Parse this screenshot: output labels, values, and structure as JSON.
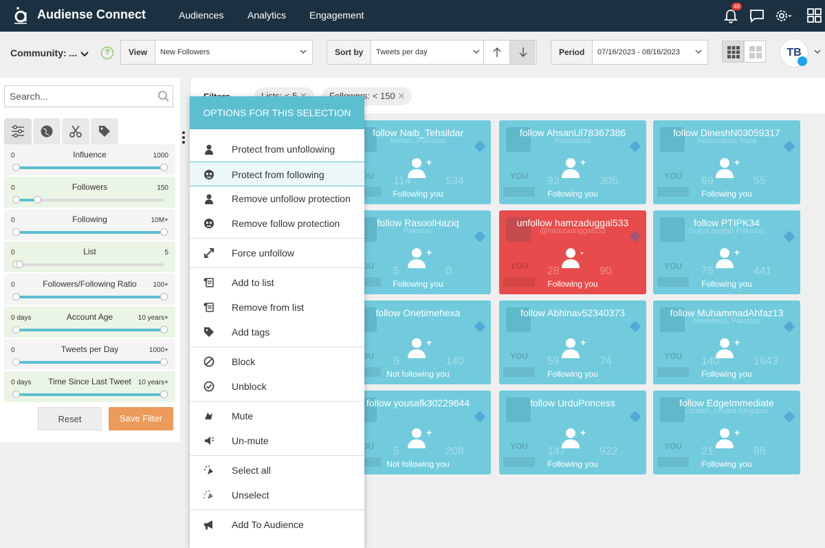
{
  "topbar": {
    "brand": "Audiense Connect",
    "nav": [
      "Audiences",
      "Analytics",
      "Engagement"
    ],
    "notification_count": "49"
  },
  "toolbar": {
    "community_label": "Community: ...",
    "help": "?",
    "view_label": "View",
    "view_value": "New Followers",
    "sort_label": "Sort by",
    "sort_value": "Tweets per day",
    "period_label": "Period",
    "period_value": "07/16/2023 - 08/16/2023",
    "avatar_text": "TB"
  },
  "sidebar": {
    "search_placeholder": "Search...",
    "filters": [
      {
        "name": "Influence",
        "lo": "0",
        "hi": "1000",
        "from": 0,
        "to": 1
      },
      {
        "name": "Followers",
        "lo": "0",
        "hi": "150",
        "from": 0,
        "to": 0.15
      },
      {
        "name": "Following",
        "lo": "0",
        "hi": "10M+",
        "from": 0,
        "to": 1
      },
      {
        "name": "List",
        "lo": "0",
        "hi": "5",
        "from": 0,
        "to": 0.03
      },
      {
        "name": "Followers/Following Ratio",
        "lo": "0",
        "hi": "100+",
        "from": 0,
        "to": 1
      },
      {
        "name": "Account Age",
        "lo": "0 days",
        "hi": "10 years+",
        "from": 0,
        "to": 1
      },
      {
        "name": "Tweets per Day",
        "lo": "0",
        "hi": "1000+",
        "from": 0,
        "to": 1
      },
      {
        "name": "Time Since Last Tweet",
        "lo": "0 days",
        "hi": "10 years+",
        "from": 0,
        "to": 1
      }
    ],
    "reset_label": "Reset",
    "save_label": "Save Filter"
  },
  "filters_bar": {
    "label": "Filters",
    "chips": [
      "Lists: < 5",
      "Followers: < 150"
    ]
  },
  "menu": {
    "header": "OPTIONS FOR THIS SELECTION",
    "items": [
      "Protect from unfollowing",
      "Protect from following",
      "Remove unfollow protection",
      "Remove follow protection",
      "Force unfollow",
      "Add to list",
      "Remove from list",
      "Add tags",
      "Block",
      "Unblock",
      "Mute",
      "Un-mute",
      "Select all",
      "Unselect",
      "Add To Audience"
    ]
  },
  "cards": [
    {
      "title": "follow Naib_Tehsildar",
      "sub": "Multan, Pakistan",
      "n1": "114",
      "n2": "534",
      "status": "Following you",
      "you": "YOU",
      "red": false
    },
    {
      "title": "follow AhsanUl78367386",
      "sub": "Rawalpindi",
      "n1": "93",
      "n2": "305",
      "status": "Following you",
      "you": "YOU",
      "red": false
    },
    {
      "title": "follow DineshN03059317",
      "sub": "Nizamabad, India",
      "n1": "69",
      "n2": "55",
      "status": "Following you",
      "you": "YOU",
      "red": false
    },
    {
      "title": "follow RasoolHaziq",
      "sub": "Pakistan",
      "n1": "5",
      "n2": "0",
      "status": "Following you",
      "you": "YOU",
      "red": false
    },
    {
      "title": "unfollow hamzaduggal533",
      "sub": "@hamzaduggal533",
      "n1": "28",
      "n2": "90",
      "status": "Following you",
      "you": "YOU",
      "red": true
    },
    {
      "title": "follow PTIPK34",
      "sub": "Gujrat punjab Pakistan",
      "n1": "75",
      "n2": "441",
      "status": "Following you",
      "you": "YOU",
      "red": false
    },
    {
      "title": "follow Onetimehexa",
      "sub": "",
      "n1": "5",
      "n2": "140",
      "status": "Not following you",
      "you": "YOU",
      "red": false
    },
    {
      "title": "follow Abhinav52340373",
      "sub": "",
      "n1": "59",
      "n2": "74",
      "status": "Following you",
      "you": "YOU",
      "red": false
    },
    {
      "title": "follow MuhammadAhfaz13",
      "sub": "Nowshera, Pakistan",
      "n1": "140",
      "n2": "1643",
      "status": "Following you",
      "you": "YOU",
      "red": false
    },
    {
      "title": "follow yousafk30229644",
      "sub": "",
      "n1": "5",
      "n2": "208",
      "status": "Not following you",
      "you": "YOU",
      "red": false
    },
    {
      "title": "follow UrduPrincess",
      "sub": "",
      "n1": "147",
      "n2": "922",
      "status": "Following you",
      "you": "YOU",
      "red": false
    },
    {
      "title": "follow EdgeImmediate",
      "sub": "London, United Kingdom",
      "n1": "21",
      "n2": "88",
      "status": "Following you",
      "you": "YOU",
      "red": false
    }
  ],
  "colors": {
    "topbar": "#1b3141",
    "accent": "#5bbfd0",
    "card": "#71cbdd",
    "card_red": "#e84b4b",
    "save": "#ec9b5b"
  }
}
